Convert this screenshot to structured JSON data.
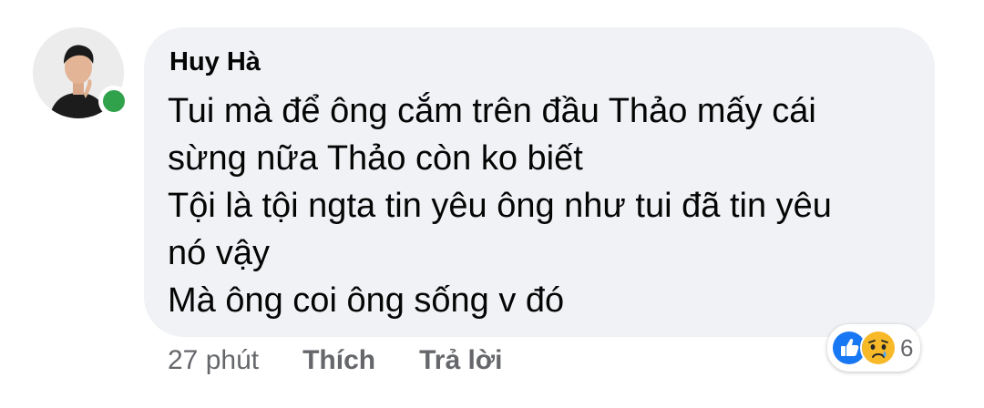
{
  "comment": {
    "author": "Huy Hà",
    "lines": [
      "Tui mà để ông cắm trên đầu Thảo mấy cái",
      "sừng nữa Thảo còn ko biết",
      "Tội là tội ngta tin yêu ông như tui đã tin yêu",
      "nó vậy",
      "Mà ông coi ông sống v đó"
    ],
    "time": "27 phút",
    "like_label": "Thích",
    "reply_label": "Trả lời",
    "reactions": {
      "types": [
        "like-icon",
        "sad-icon"
      ],
      "count": "6"
    },
    "online": true
  },
  "colors": {
    "bubble": "#f0f2f5",
    "online": "#31a24c",
    "like": "#1877f2",
    "sad": "#f7b928",
    "secondary_text": "#65676b"
  }
}
